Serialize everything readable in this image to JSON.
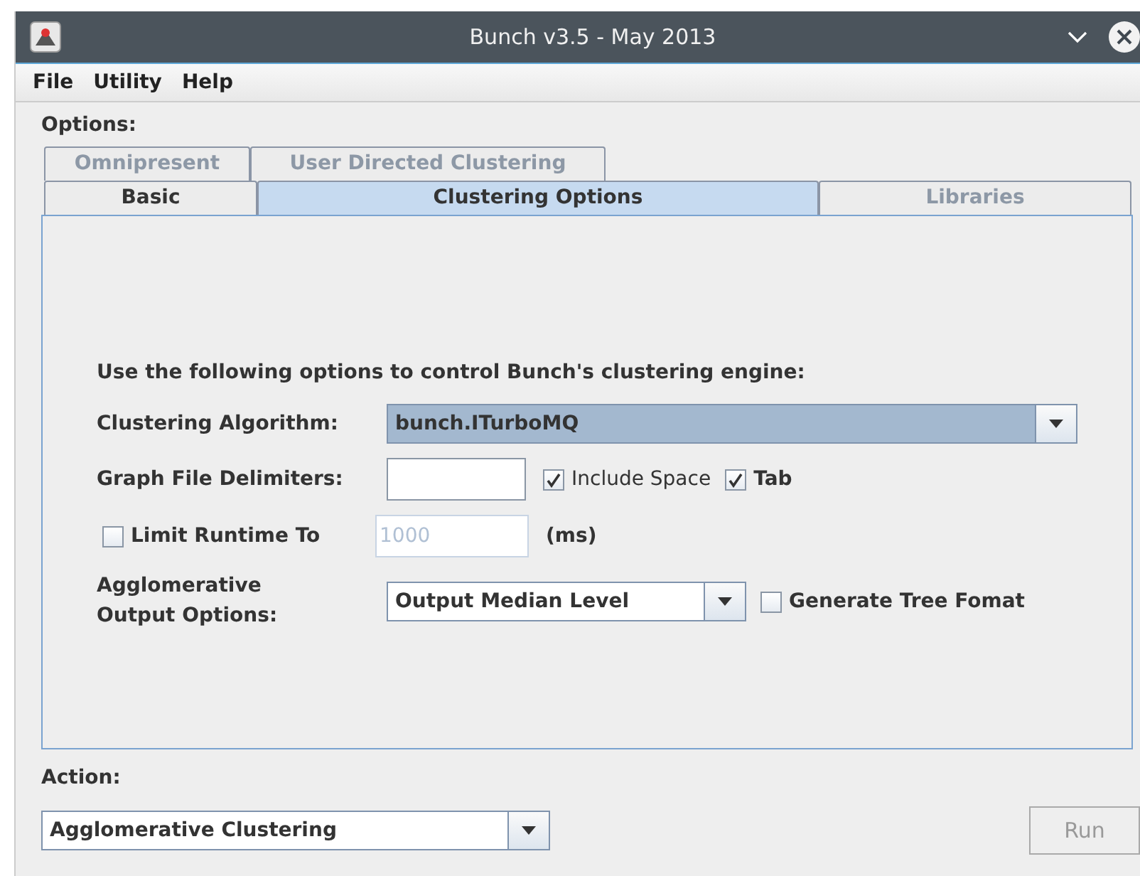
{
  "window": {
    "title": "Bunch v3.5 - May 2013"
  },
  "menu": [
    {
      "label": "File"
    },
    {
      "label": "Utility"
    },
    {
      "label": "Help"
    }
  ],
  "options_label": "Options:",
  "tab_rows": [
    [
      {
        "label": "Omnipresent",
        "selected": false,
        "disabled": true
      },
      {
        "label": "User Directed Clustering",
        "selected": false,
        "disabled": true
      }
    ],
    [
      {
        "label": "Basic",
        "selected": false,
        "disabled": false
      },
      {
        "label": "Clustering Options",
        "selected": true,
        "disabled": false
      },
      {
        "label": "Libraries",
        "selected": false,
        "disabled": true
      }
    ]
  ],
  "panel": {
    "intro": "Use the following options to control Bunch's clustering engine:",
    "algorithm": {
      "label": "Clustering Algorithm:",
      "value": "bunch.ITurboMQ"
    },
    "delimiters": {
      "label": "Graph File Delimiters:",
      "checks": [
        {
          "label": "Include Space",
          "checked": true,
          "bold": false
        },
        {
          "label": "Tab",
          "checked": true,
          "bold": true
        }
      ]
    },
    "limit": {
      "label": "Limit Runtime To",
      "checked": false,
      "value": "1000",
      "disabled": true,
      "unit": "(ms)"
    },
    "agglomerative": {
      "label_lines": [
        "Agglomerative",
        "Output Options:"
      ],
      "value": "Output Median Level",
      "tree": {
        "label": "Generate Tree Fomat",
        "checked": false
      }
    }
  },
  "action": {
    "label": "Action:",
    "value": "Agglomerative Clustering"
  },
  "run_button": {
    "label": "Run",
    "disabled": true
  }
}
